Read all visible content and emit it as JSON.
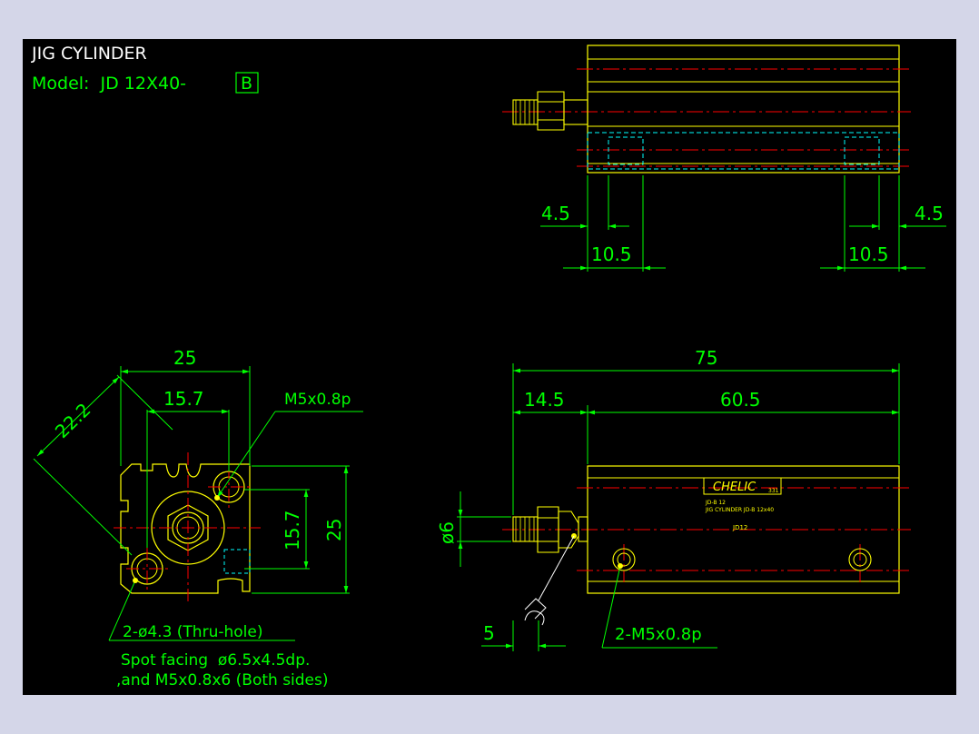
{
  "title": "JIG CYLINDER",
  "model": {
    "prefix": "Model:  JD 12X40-",
    "boxed": "B"
  },
  "colors": {
    "green": "#00ff00",
    "yellow": "#ffff00",
    "red": "#ff0000",
    "cyan": "#00ffff",
    "white": "#ffffff",
    "background": "#000000",
    "page": "#d4d6e8"
  },
  "top_view": {
    "dim_left_offset": "4.5",
    "dim_left_width": "10.5",
    "dim_right_offset": "4.5",
    "dim_right_width": "10.5"
  },
  "end_view": {
    "dim_width": "25",
    "dim_diagonal": "22.2",
    "dim_hole_pitch": "15.7",
    "dim_height": "25",
    "dim_hole_pitch_v": "15.7",
    "thread_callout": "M5x0.8p",
    "note_line1": "2-ø4.3 (Thru-hole)",
    "note_line2": "Spot facing  ø6.5x4.5dp.",
    "note_line3": ",and M5x0.8x6 (Both sides)"
  },
  "front_view": {
    "dim_total": "75",
    "dim_rod": "14.5",
    "dim_body": "60.5",
    "dim_rod_dia": "ø6",
    "dim_wrench": "5",
    "port_callout": "2-M5x0.8p",
    "label_brand": "CHELIC",
    "label_code": "331",
    "label_line1": "JD-B 12",
    "label_line2": "JIG CYLINDER  JD-B 12x40",
    "label_model": "JD12"
  }
}
